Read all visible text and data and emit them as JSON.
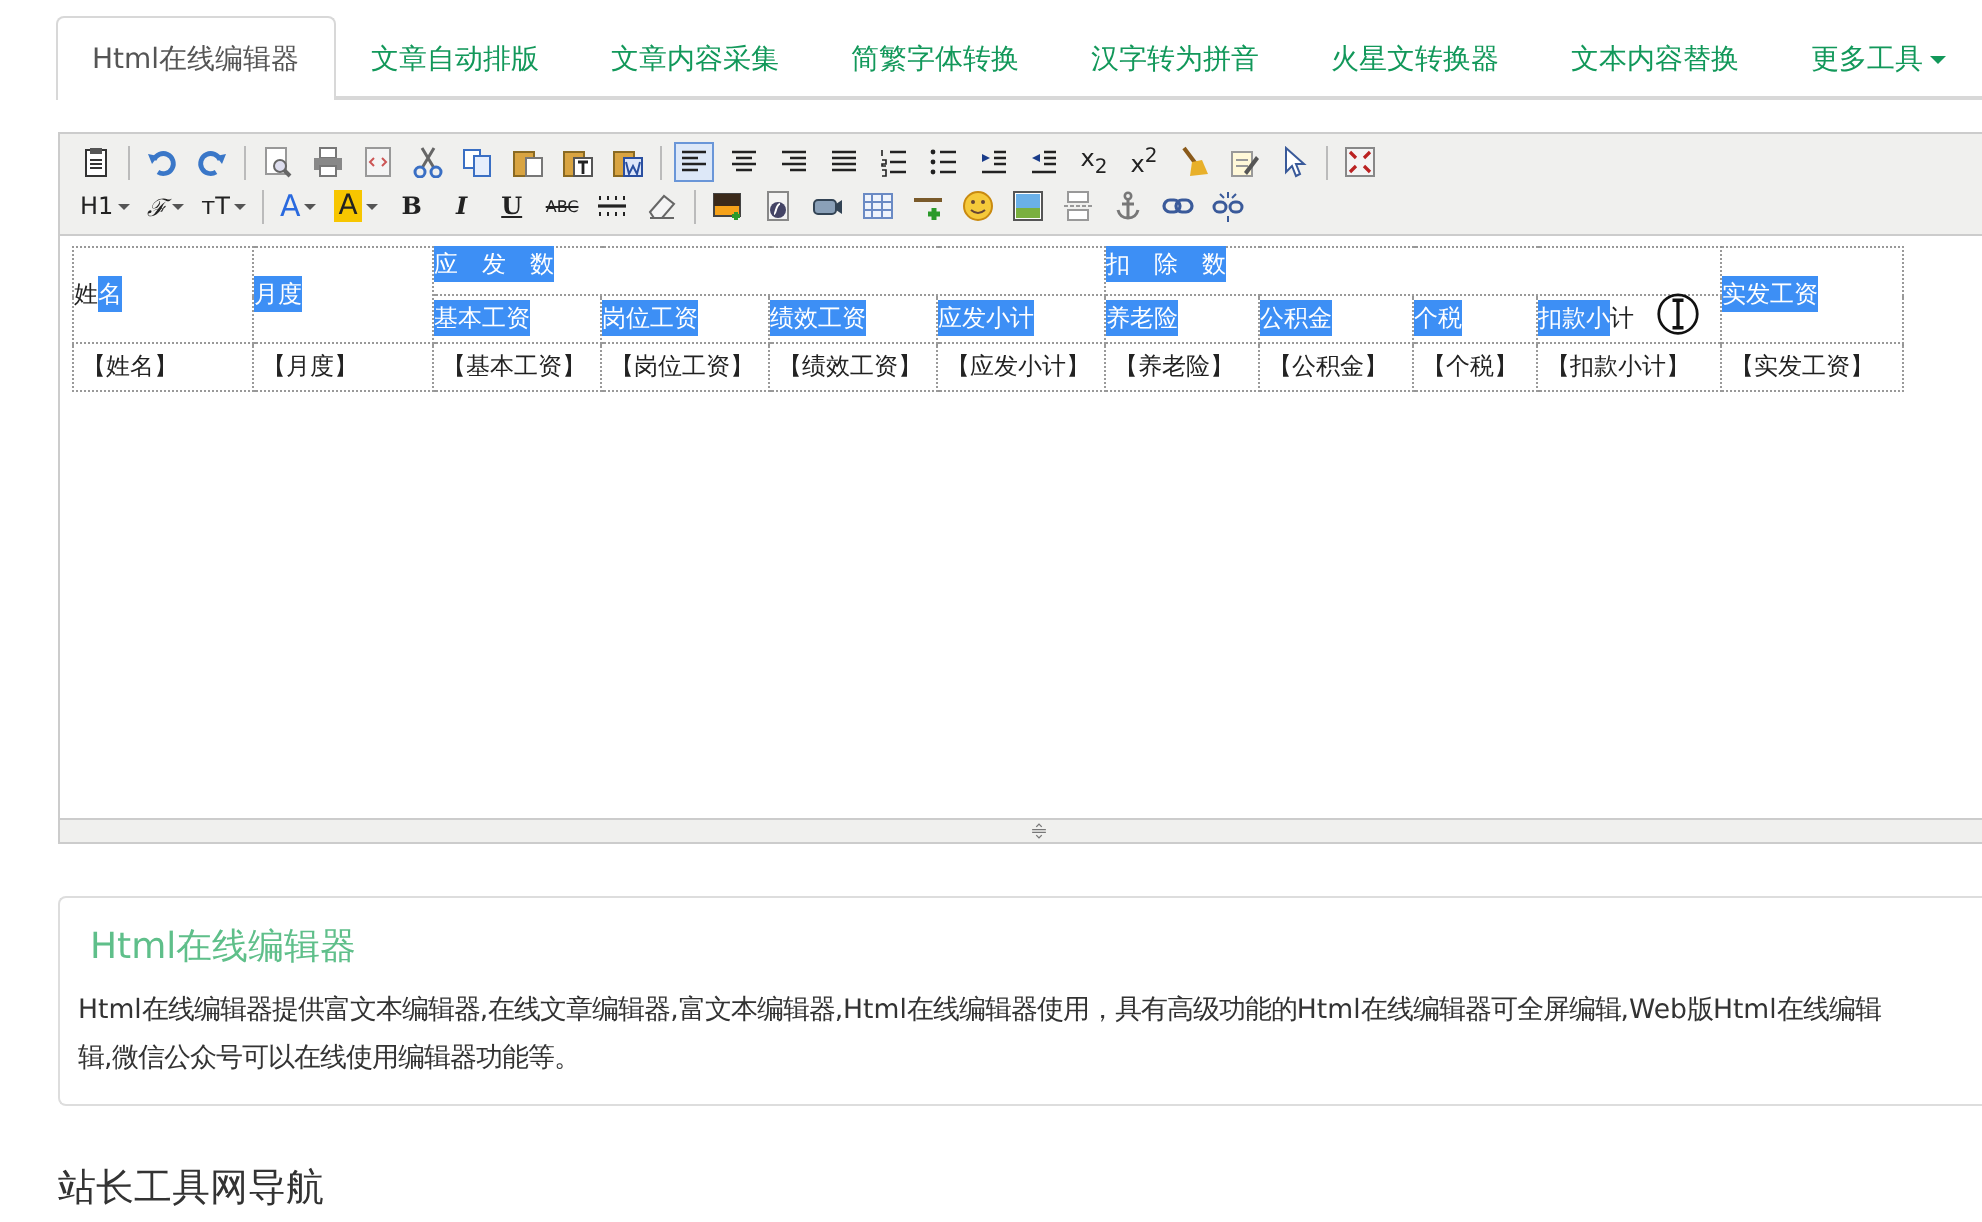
{
  "tabs": [
    {
      "label": "Html在线编辑器",
      "selected": true,
      "dropdown": false
    },
    {
      "label": "文章自动排版",
      "selected": false,
      "dropdown": false
    },
    {
      "label": "文章内容采集",
      "selected": false,
      "dropdown": false
    },
    {
      "label": "简繁字体转换",
      "selected": false,
      "dropdown": false
    },
    {
      "label": "汉字转为拼音",
      "selected": false,
      "dropdown": false
    },
    {
      "label": "火星文转换器",
      "selected": false,
      "dropdown": false
    },
    {
      "label": "文本内容替换",
      "selected": false,
      "dropdown": false
    },
    {
      "label": "更多工具",
      "selected": false,
      "dropdown": true
    }
  ],
  "toolbar": {
    "rows": [
      [
        {
          "kind": "icon",
          "active": false
        },
        {
          "kind": "sep"
        },
        {
          "kind": "icon",
          "active": false
        },
        {
          "kind": "icon",
          "active": false
        },
        {
          "kind": "sep"
        },
        {
          "kind": "icon",
          "active": false
        },
        {
          "kind": "icon",
          "active": false
        },
        {
          "kind": "icon",
          "active": false
        },
        {
          "kind": "icon",
          "active": false
        },
        {
          "kind": "icon",
          "active": false
        },
        {
          "kind": "icon",
          "active": false
        },
        {
          "kind": "icon",
          "active": false
        },
        {
          "kind": "icon",
          "active": false
        },
        {
          "kind": "sep"
        },
        {
          "kind": "icon",
          "active": true
        },
        {
          "kind": "icon",
          "active": false
        },
        {
          "kind": "icon",
          "active": false
        },
        {
          "kind": "icon",
          "active": false
        },
        {
          "kind": "icon",
          "active": false
        },
        {
          "kind": "icon",
          "active": false
        },
        {
          "kind": "icon",
          "active": false
        },
        {
          "kind": "icon",
          "active": false
        },
        {
          "kind": "text",
          "label": "x$_{2}$",
          "dropdown": false
        },
        {
          "kind": "text",
          "label": "x$^{2}$",
          "dropdown": false
        },
        {
          "kind": "icon",
          "active": false
        },
        {
          "kind": "icon",
          "active": false
        },
        {
          "kind": "icon",
          "active": false
        },
        {
          "kind": "sep"
        },
        {
          "kind": "icon",
          "active": false
        }
      ],
      [
        {
          "kind": "text",
          "label": "H1",
          "dropdown": true
        },
        {
          "kind": "text",
          "label": "ℱ",
          "dropdown": true
        },
        {
          "kind": "text",
          "label": "ᴛT",
          "dropdown": true
        },
        {
          "kind": "sep"
        },
        {
          "kind": "text",
          "label": "A",
          "dropdown": true
        },
        {
          "kind": "text",
          "label": "A",
          "dropdown": true
        },
        {
          "kind": "text",
          "label": "B",
          "dropdown": false
        },
        {
          "kind": "text",
          "label": "I",
          "dropdown": false
        },
        {
          "kind": "text",
          "label": "U",
          "dropdown": false
        },
        {
          "kind": "text",
          "label": "ABC",
          "dropdown": false
        },
        {
          "kind": "icon",
          "active": false
        },
        {
          "kind": "icon",
          "active": false
        },
        {
          "kind": "sep"
        },
        {
          "kind": "icon",
          "active": false
        },
        {
          "kind": "icon",
          "active": false
        },
        {
          "kind": "icon",
          "active": false
        },
        {
          "kind": "icon",
          "active": false
        },
        {
          "kind": "icon",
          "active": false
        },
        {
          "kind": "icon",
          "active": false
        },
        {
          "kind": "icon",
          "active": false
        },
        {
          "kind": "icon",
          "active": false
        },
        {
          "kind": "icon",
          "active": false
        },
        {
          "kind": "icon",
          "active": false
        },
        {
          "kind": "icon",
          "active": false
        }
      ]
    ]
  },
  "table": {
    "rows": [
      [
        {
          "rowspan": 2,
          "segments": [
            {
              "text": "姓",
              "selected": false
            },
            {
              "text": "名",
              "selected": true
            }
          ]
        },
        {
          "rowspan": 2,
          "segments": [
            {
              "text": "月度",
              "selected": true
            }
          ]
        },
        {
          "colspan": 4,
          "segments": [
            {
              "text": "应　发　数",
              "selected": true
            }
          ]
        },
        {
          "colspan": 4,
          "segments": [
            {
              "text": "扣　除　数",
              "selected": true
            }
          ]
        },
        {
          "rowspan": 2,
          "segments": [
            {
              "text": "实发工资",
              "selected": true
            }
          ]
        }
      ],
      [
        {
          "segments": [
            {
              "text": "基本工资",
              "selected": true
            }
          ]
        },
        {
          "segments": [
            {
              "text": "岗位工资",
              "selected": true
            }
          ]
        },
        {
          "segments": [
            {
              "text": "绩效工资",
              "selected": true
            }
          ]
        },
        {
          "segments": [
            {
              "text": "应发小计",
              "selected": true
            }
          ]
        },
        {
          "segments": [
            {
              "text": "养老险",
              "selected": true
            }
          ]
        },
        {
          "segments": [
            {
              "text": "公积金",
              "selected": true
            }
          ]
        },
        {
          "segments": [
            {
              "text": "个税",
              "selected": true
            }
          ]
        },
        {
          "segments": [
            {
              "text": "扣款小",
              "selected": true
            },
            {
              "text": "计",
              "selected": false
            }
          ]
        }
      ],
      [
        {
          "segments": [
            {
              "text": "【姓名】",
              "selected": false
            }
          ]
        },
        {
          "segments": [
            {
              "text": "【月度】",
              "selected": false
            }
          ]
        },
        {
          "segments": [
            {
              "text": "【基本工资】",
              "selected": false
            }
          ]
        },
        {
          "segments": [
            {
              "text": "【岗位工资】",
              "selected": false
            }
          ]
        },
        {
          "segments": [
            {
              "text": "【绩效工资】",
              "selected": false
            }
          ]
        },
        {
          "segments": [
            {
              "text": "【应发小计】",
              "selected": false
            }
          ]
        },
        {
          "segments": [
            {
              "text": "【养老险】",
              "selected": false
            }
          ]
        },
        {
          "segments": [
            {
              "text": "【公积金】",
              "selected": false
            }
          ]
        },
        {
          "segments": [
            {
              "text": "【个税】",
              "selected": false
            }
          ]
        },
        {
          "segments": [
            {
              "text": "【扣款小计】",
              "selected": false
            }
          ]
        },
        {
          "segments": [
            {
              "text": "【实发工资】",
              "selected": false
            }
          ]
        }
      ]
    ]
  },
  "card": {
    "title": "Html在线编辑器",
    "lines": [
      "Html在线编辑器提供富文本编辑器,在线文章编辑器,富文本编辑器,Html在线编辑器使用，具有高级功能的Html在线编辑器可全屏编辑,Web版Html在线编辑",
      "辑,微信公众号可以在线使用编辑器功能等。"
    ]
  },
  "section_heading": "站长工具网导航"
}
